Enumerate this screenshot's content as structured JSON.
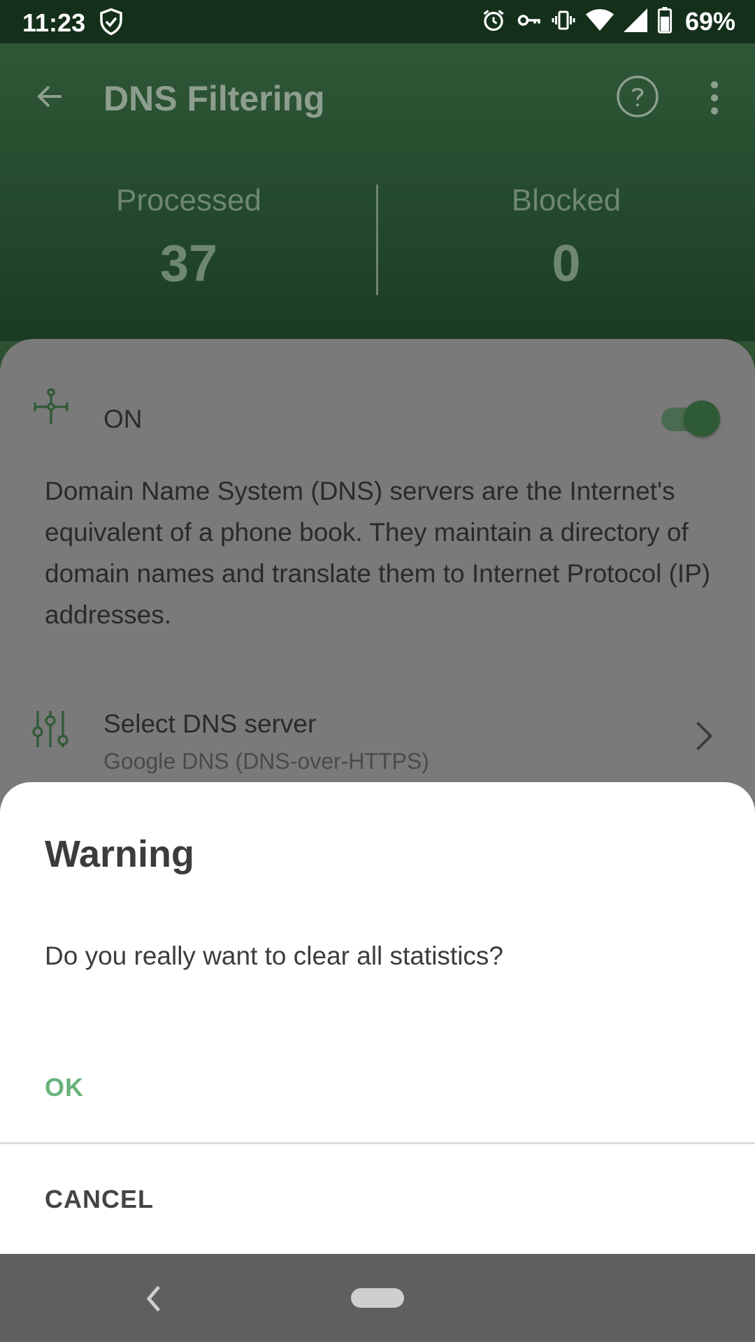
{
  "status_bar": {
    "time": "11:23",
    "battery_percent": "69%",
    "icons": [
      "shield-check-icon",
      "alarm-icon",
      "vpn-key-icon",
      "vibrate-icon",
      "wifi-icon",
      "cellular-signal-icon",
      "battery-icon"
    ]
  },
  "header": {
    "title": "DNS Filtering",
    "processed_label": "Processed",
    "processed_value": "37",
    "blocked_label": "Blocked",
    "blocked_value": "0"
  },
  "content": {
    "toggle_label": "ON",
    "toggle_on": true,
    "description": "Domain Name System (DNS) servers are the Internet's equivalent of a phone book. They maintain a directory of domain names and translate them to Internet Protocol (IP) addresses.",
    "dns_server_title": "Select DNS server",
    "dns_server_value": "Google DNS (DNS-over-HTTPS)"
  },
  "dialog": {
    "title": "Warning",
    "message": "Do you really want to clear all statistics?",
    "ok_label": "OK",
    "cancel_label": "CANCEL"
  },
  "colors": {
    "accent_green": "#67b279",
    "header_green": "#2f5736",
    "status_bar": "#14301b"
  }
}
